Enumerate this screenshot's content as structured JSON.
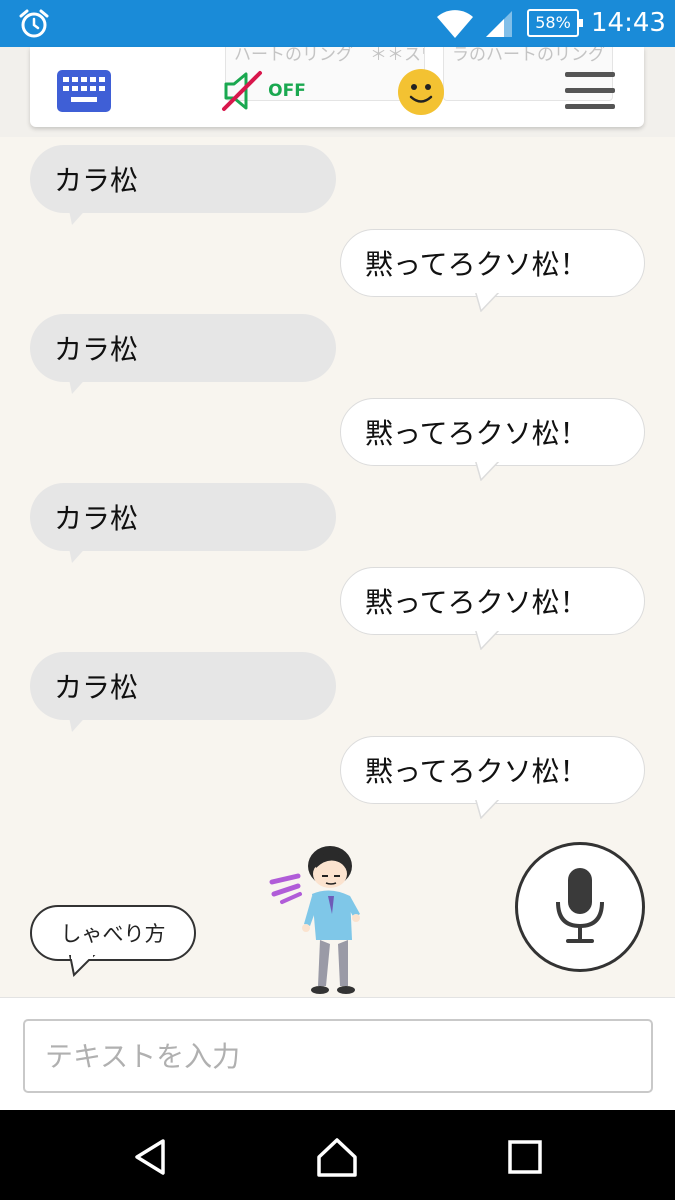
{
  "status_bar": {
    "battery": "58%",
    "time": "14:43"
  },
  "toolbar": {
    "keyboard_icon": "keyboard-icon",
    "sound_toggle_label": "OFF",
    "ghost_cards": [
      "ハートのリング　＊＊スワ…",
      "ラのハートのリング　＊＊ス…"
    ]
  },
  "messages": [
    {
      "side": "left",
      "text": "カラ松"
    },
    {
      "side": "right",
      "text": "黙ってろクソ松！"
    },
    {
      "side": "left",
      "text": "カラ松"
    },
    {
      "side": "right",
      "text": "黙ってろクソ松！"
    },
    {
      "side": "left",
      "text": "カラ松"
    },
    {
      "side": "right",
      "text": "黙ってろクソ松！"
    },
    {
      "side": "left",
      "text": "カラ松"
    },
    {
      "side": "right",
      "text": "黙ってろクソ松！"
    }
  ],
  "howto_label": "しゃべり方",
  "input": {
    "placeholder": "テキストを入力",
    "value": ""
  },
  "colors": {
    "status_bar": "#1a8bd8",
    "chat_bg": "#f8f5ef",
    "left_bubble": "#e6e6e6",
    "right_bubble": "#ffffff",
    "off_green": "#1aa850",
    "mute_red": "#d8174c",
    "keyboard_blue": "#3f5fd6",
    "face_yellow": "#f3c232"
  }
}
